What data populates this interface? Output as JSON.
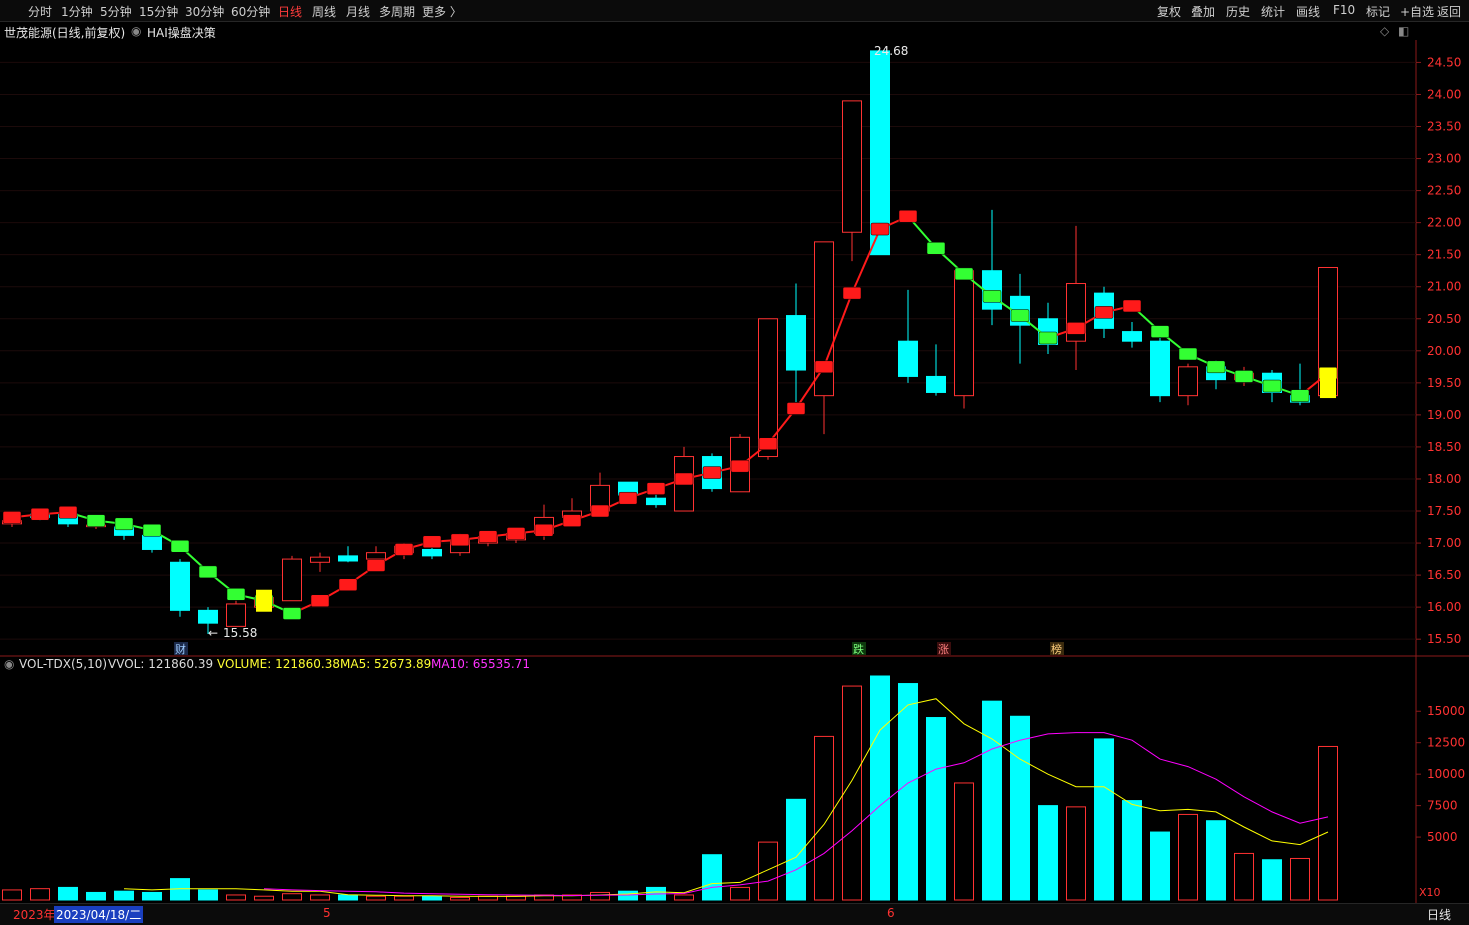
{
  "toolbar": {
    "periods": [
      "分时",
      "1分钟",
      "5分钟",
      "15分钟",
      "30分钟",
      "60分钟",
      "日线",
      "周线",
      "月线",
      "多周期",
      "更多 〉"
    ],
    "active_period": "日线",
    "right_tools": [
      "复权",
      "叠加",
      "历史",
      "统计",
      "画线",
      "F10",
      "标记",
      "+自选",
      "返回"
    ]
  },
  "title": {
    "stock": "世茂能源(日线,前复权)",
    "indicator": "HAI操盘决策"
  },
  "volume_info": {
    "name": "VOL-TDX(5,10)",
    "vvol": "VVOL: 121860.39",
    "volume": "VOLUME: 121860.38",
    "ma5": "MA5: 52673.89",
    "ma10": "MA10: 65535.71"
  },
  "colors": {
    "up": "#ff3232",
    "down": "#00ffff",
    "ma_up": "#ff1a1a",
    "ma_down": "#33ff33",
    "ma5_line": "#ffff00",
    "ma10_line": "#ff00ff",
    "axis_text": "#ff3232"
  },
  "markers": {
    "high_label": "24.68",
    "low_label": "15.58",
    "badges": [
      "财",
      "跌",
      "涨",
      "榜"
    ]
  },
  "bottom": {
    "year": "2023年",
    "date": "2023/04/18/二",
    "month5": "5",
    "month6": "6",
    "x10": "X10",
    "period": "日线"
  },
  "chart_data": [
    {
      "type": "candlestick",
      "y_ticks": [
        "24.50",
        "24.00",
        "23.50",
        "23.00",
        "22.50",
        "22.00",
        "21.50",
        "21.00",
        "20.50",
        "20.00",
        "19.50",
        "19.00",
        "18.50",
        "18.00",
        "17.50",
        "17.00",
        "16.50",
        "16.00",
        "15.50"
      ],
      "ylim": [
        15.3,
        24.85
      ],
      "candles": [
        {
          "o": 17.3,
          "c": 17.35,
          "h": 17.45,
          "l": 17.25
        },
        {
          "o": 17.45,
          "c": 17.4,
          "h": 17.5,
          "l": 17.35
        },
        {
          "o": 17.45,
          "c": 17.3,
          "h": 17.55,
          "l": 17.25
        },
        {
          "o": 17.28,
          "c": 17.28,
          "h": 17.35,
          "l": 17.22
        },
        {
          "o": 17.25,
          "c": 17.12,
          "h": 17.3,
          "l": 17.05
        },
        {
          "o": 17.12,
          "c": 16.9,
          "h": 17.18,
          "l": 16.85
        },
        {
          "o": 16.7,
          "c": 15.95,
          "h": 16.75,
          "l": 15.85
        },
        {
          "o": 15.95,
          "c": 15.75,
          "h": 16.0,
          "l": 15.58
        },
        {
          "o": 15.7,
          "c": 16.05,
          "h": 16.1,
          "l": 15.7
        },
        {
          "o": 16.0,
          "c": 16.15,
          "h": 16.25,
          "l": 15.95
        },
        {
          "o": 16.1,
          "c": 16.75,
          "h": 16.8,
          "l": 16.1
        },
        {
          "o": 16.7,
          "c": 16.78,
          "h": 16.85,
          "l": 16.55
        },
        {
          "o": 16.8,
          "c": 16.72,
          "h": 16.95,
          "l": 16.7
        },
        {
          "o": 16.75,
          "c": 16.85,
          "h": 16.95,
          "l": 16.7
        },
        {
          "o": 16.85,
          "c": 16.95,
          "h": 17.0,
          "l": 16.75
        },
        {
          "o": 16.9,
          "c": 16.8,
          "h": 16.95,
          "l": 16.75
        },
        {
          "o": 16.85,
          "c": 17.05,
          "h": 17.15,
          "l": 16.8
        },
        {
          "o": 17.0,
          "c": 17.1,
          "h": 17.15,
          "l": 16.95
        },
        {
          "o": 17.05,
          "c": 17.15,
          "h": 17.2,
          "l": 17.0
        },
        {
          "o": 17.15,
          "c": 17.4,
          "h": 17.6,
          "l": 17.05
        },
        {
          "o": 17.4,
          "c": 17.5,
          "h": 17.7,
          "l": 17.35
        },
        {
          "o": 17.5,
          "c": 17.9,
          "h": 18.1,
          "l": 17.45
        },
        {
          "o": 17.95,
          "c": 17.75,
          "h": 17.95,
          "l": 17.65
        },
        {
          "o": 17.7,
          "c": 17.6,
          "h": 17.85,
          "l": 17.55
        },
        {
          "o": 17.5,
          "c": 18.35,
          "h": 18.5,
          "l": 17.5
        },
        {
          "o": 18.35,
          "c": 17.85,
          "h": 18.4,
          "l": 17.8
        },
        {
          "o": 17.8,
          "c": 18.65,
          "h": 18.7,
          "l": 17.8
        },
        {
          "o": 18.35,
          "c": 20.5,
          "h": 20.5,
          "l": 18.3
        },
        {
          "o": 20.55,
          "c": 19.7,
          "h": 21.05,
          "l": 19.2
        },
        {
          "o": 19.3,
          "c": 21.7,
          "h": 21.7,
          "l": 18.7
        },
        {
          "o": 21.85,
          "c": 23.9,
          "h": 23.9,
          "l": 21.4
        },
        {
          "o": 24.68,
          "c": 21.5,
          "h": 24.68,
          "l": 21.5
        },
        {
          "o": 20.15,
          "c": 19.6,
          "h": 20.95,
          "l": 19.5
        },
        {
          "o": 19.6,
          "c": 19.35,
          "h": 20.1,
          "l": 19.3
        },
        {
          "o": 19.3,
          "c": 21.25,
          "h": 21.25,
          "l": 19.1
        },
        {
          "o": 21.25,
          "c": 20.65,
          "h": 22.2,
          "l": 20.4
        },
        {
          "o": 20.85,
          "c": 20.4,
          "h": 21.2,
          "l": 19.8
        },
        {
          "o": 20.5,
          "c": 20.1,
          "h": 20.75,
          "l": 19.95
        },
        {
          "o": 20.15,
          "c": 21.05,
          "h": 21.95,
          "l": 19.7
        },
        {
          "o": 20.9,
          "c": 20.35,
          "h": 21.0,
          "l": 20.2
        },
        {
          "o": 20.3,
          "c": 20.15,
          "h": 20.45,
          "l": 20.05
        },
        {
          "o": 20.15,
          "c": 19.3,
          "h": 20.2,
          "l": 19.2
        },
        {
          "o": 19.3,
          "c": 19.75,
          "h": 19.8,
          "l": 19.15
        },
        {
          "o": 19.75,
          "c": 19.55,
          "h": 19.85,
          "l": 19.4
        },
        {
          "o": 19.55,
          "c": 19.65,
          "h": 19.75,
          "l": 19.45
        },
        {
          "o": 19.65,
          "c": 19.35,
          "h": 19.7,
          "l": 19.2
        },
        {
          "o": 19.3,
          "c": 19.2,
          "h": 19.8,
          "l": 19.15
        },
        {
          "o": 19.3,
          "c": 21.3,
          "h": 21.3,
          "l": 19.3
        }
      ],
      "ma": [
        17.4,
        17.45,
        17.48,
        17.35,
        17.3,
        17.2,
        16.95,
        16.55,
        16.2,
        16.1,
        15.9,
        16.1,
        16.35,
        16.65,
        16.9,
        17.02,
        17.05,
        17.1,
        17.15,
        17.2,
        17.35,
        17.5,
        17.7,
        17.85,
        18.0,
        18.1,
        18.2,
        18.55,
        19.1,
        19.75,
        20.9,
        21.9,
        22.1,
        21.6,
        21.2,
        20.85,
        20.55,
        20.2,
        20.35,
        20.6,
        20.7,
        20.3,
        19.95,
        19.75,
        19.6,
        19.45,
        19.3,
        19.65
      ],
      "ma_trend": [
        "u",
        "u",
        "u",
        "d",
        "d",
        "d",
        "d",
        "d",
        "d",
        "d",
        "d",
        "u",
        "u",
        "u",
        "u",
        "u",
        "u",
        "u",
        "u",
        "u",
        "u",
        "u",
        "u",
        "u",
        "u",
        "u",
        "u",
        "u",
        "u",
        "u",
        "u",
        "u",
        "u",
        "d",
        "d",
        "d",
        "d",
        "d",
        "u",
        "u",
        "u",
        "d",
        "d",
        "d",
        "d",
        "d",
        "d",
        "u"
      ],
      "high": {
        "value": "24.68",
        "index": 31
      },
      "low": {
        "value": "15.58",
        "index": 7
      }
    },
    {
      "type": "bar",
      "y_ticks": [
        "15000",
        "12500",
        "10000",
        "7500",
        "5000"
      ],
      "ylim": [
        0,
        17800
      ],
      "volumes": [
        800,
        900,
        1000,
        600,
        700,
        600,
        1700,
        800,
        400,
        300,
        500,
        400,
        400,
        300,
        300,
        300,
        200,
        300,
        300,
        400,
        400,
        600,
        700,
        1000,
        400,
        3600,
        1000,
        4600,
        8000,
        13000,
        17000,
        17800,
        17200,
        14500,
        9300,
        15800,
        14600,
        7500,
        7400,
        12800,
        7900,
        5400,
        6800,
        6300,
        3700,
        3200,
        3300,
        12200
      ],
      "up": [
        true,
        true,
        false,
        false,
        false,
        false,
        false,
        false,
        true,
        true,
        true,
        true,
        false,
        true,
        true,
        false,
        true,
        true,
        true,
        true,
        true,
        true,
        false,
        false,
        true,
        false,
        true,
        true,
        false,
        true,
        true,
        false,
        false,
        false,
        true,
        false,
        false,
        false,
        true,
        false,
        false,
        false,
        true,
        false,
        true,
        false,
        true,
        true
      ],
      "ma5": [
        null,
        null,
        null,
        null,
        900,
        800,
        900,
        900,
        900,
        800,
        700,
        700,
        420,
        380,
        340,
        340,
        300,
        290,
        290,
        330,
        340,
        400,
        480,
        640,
        580,
        1300,
        1400,
        2400,
        3400,
        6000,
        9500,
        13500,
        15500,
        16000,
        14000,
        12800,
        11200,
        10000,
        9000,
        9000,
        7600,
        7100,
        7200,
        7000,
        5800,
        4700,
        4400,
        5400
      ],
      "ma10": [
        null,
        null,
        null,
        null,
        null,
        null,
        null,
        null,
        null,
        900,
        800,
        750,
        700,
        650,
        550,
        500,
        450,
        420,
        400,
        380,
        360,
        380,
        400,
        480,
        520,
        1000,
        1200,
        1500,
        2400,
        3700,
        5500,
        7500,
        9300,
        10400,
        10900,
        12000,
        12700,
        13200,
        13300,
        13300,
        12700,
        11200,
        10600,
        9600,
        8200,
        7000,
        6100,
        6600
      ]
    }
  ]
}
